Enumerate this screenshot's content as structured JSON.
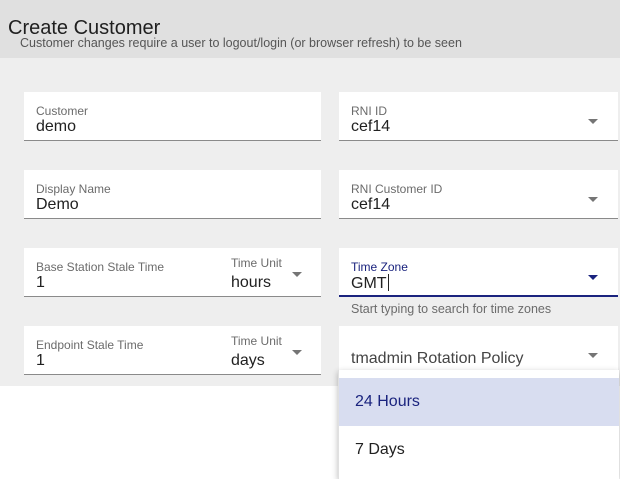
{
  "header": {
    "title": "Create Customer",
    "subtitle": "Customer changes require a user to logout/login (or browser refresh) to be seen"
  },
  "form": {
    "customer": {
      "label": "Customer",
      "value": "demo"
    },
    "rni_id": {
      "label": "RNI ID",
      "value": "cef14"
    },
    "display_name": {
      "label": "Display Name",
      "value": "Demo"
    },
    "rni_customer_id": {
      "label": "RNI Customer ID",
      "value": "cef14"
    },
    "base_station_stale_time": {
      "label": "Base Station Stale Time",
      "value": "1"
    },
    "base_station_time_unit": {
      "label": "Time Unit",
      "value": "hours"
    },
    "time_zone": {
      "label": "Time Zone",
      "value": "GMT",
      "hint": "Start typing to search for time zones"
    },
    "endpoint_stale_time": {
      "label": "Endpoint Stale Time",
      "value": "1"
    },
    "endpoint_time_unit": {
      "label": "Time Unit",
      "value": "days"
    },
    "rotation_policy": {
      "placeholder": "tmadmin Rotation Policy"
    }
  },
  "dropdown": {
    "options": [
      {
        "label": "24 Hours",
        "selected": true
      },
      {
        "label": "7 Days",
        "selected": false
      }
    ]
  },
  "colors": {
    "header_bg": "#e0e0e0",
    "content_bg": "#eeeeee",
    "accent": "#1a237e",
    "selected_option_bg": "#d8ddf0"
  },
  "icons": [
    "dropdown-arrow-icon"
  ]
}
